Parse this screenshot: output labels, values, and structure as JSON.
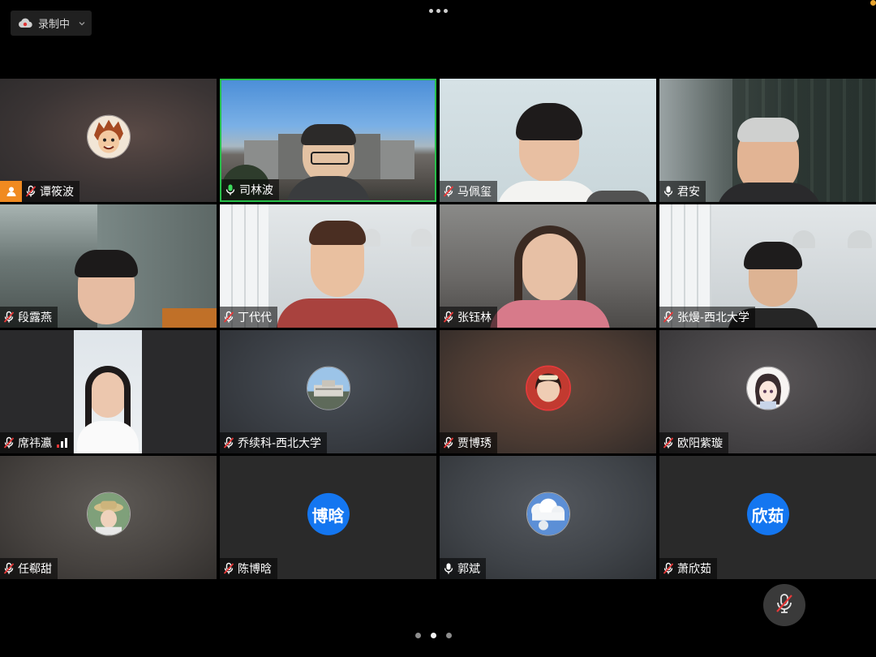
{
  "top": {
    "recording_label": "录制中"
  },
  "tiles": [
    {
      "name": "谭筱波",
      "mic": "muted",
      "host": true
    },
    {
      "name": "司林波",
      "mic": "on",
      "speaking": true
    },
    {
      "name": "马佩玺",
      "mic": "muted"
    },
    {
      "name": "君安",
      "mic": "on"
    },
    {
      "name": "段露燕",
      "mic": "muted"
    },
    {
      "name": "丁代代",
      "mic": "muted"
    },
    {
      "name": "张钰林",
      "mic": "muted"
    },
    {
      "name": "张熳-西北大学",
      "mic": "muted"
    },
    {
      "name": "席祎瀛",
      "mic": "muted"
    },
    {
      "name": "乔续科-西北大学",
      "mic": "muted"
    },
    {
      "name": "贾博琇",
      "mic": "muted"
    },
    {
      "name": "欧阳紫璇",
      "mic": "muted"
    },
    {
      "name": "任郗甜",
      "mic": "muted"
    },
    {
      "name": "陈博晗",
      "mic": "muted",
      "avatar_text": "博晗"
    },
    {
      "name": "郭斌",
      "mic": "on"
    },
    {
      "name": "萧欣茹",
      "mic": "muted",
      "avatar_text": "欣茹"
    }
  ],
  "pager": {
    "pages": 3,
    "current": 2
  },
  "colors": {
    "speaking_border": "#27c04a",
    "host_badge": "#f08a20",
    "text_avatar": "#1476f0"
  }
}
